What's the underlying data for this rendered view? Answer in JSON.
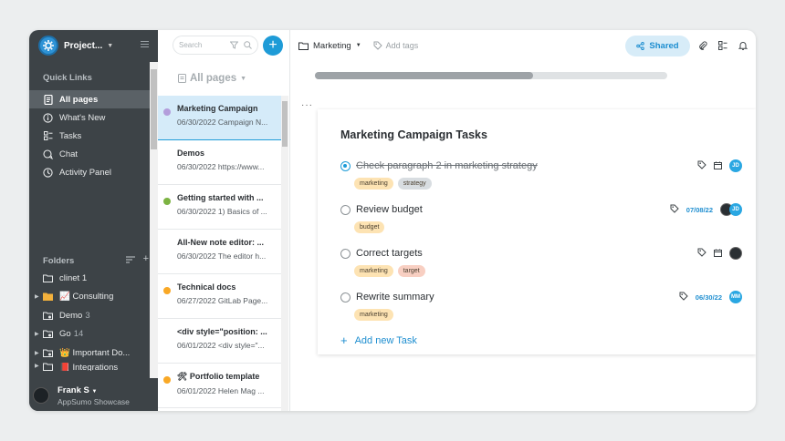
{
  "sidebar": {
    "workspace_name": "Project...",
    "quick_links_title": "Quick Links",
    "quick_links": [
      {
        "label": "All pages",
        "icon": "pages-icon"
      },
      {
        "label": "What's New",
        "icon": "info-icon"
      },
      {
        "label": "Tasks",
        "icon": "tasks-icon"
      },
      {
        "label": "Chat",
        "icon": "chat-icon"
      },
      {
        "label": "Activity Panel",
        "icon": "activity-icon"
      }
    ],
    "folders_title": "Folders",
    "folders": [
      {
        "name": "clinet 1",
        "count": ""
      },
      {
        "name": "📈 Consulting",
        "count": ""
      },
      {
        "name": "Demo",
        "count": "3"
      },
      {
        "name": "Go",
        "count": "14"
      },
      {
        "name": "👑 Important Do...",
        "count": ""
      },
      {
        "name": "📕 Integrations",
        "count": ""
      }
    ],
    "profile": {
      "name": "Frank S",
      "subtitle": "AppSumo Showcase"
    }
  },
  "notes_list": {
    "search_placeholder": "Search",
    "header": "All pages",
    "notes": [
      {
        "title": "Marketing Campaign",
        "meta": "06/30/2022 Campaign N...",
        "dot": "#b39ddb"
      },
      {
        "title": "Demos",
        "meta": "06/30/2022 https://www...",
        "dot": ""
      },
      {
        "title": "Getting started with ...",
        "meta": "06/30/2022 1) Basics of ...",
        "dot": "#7cb342"
      },
      {
        "title": "All-New note editor: ...",
        "meta": "06/30/2022 The editor h...",
        "dot": ""
      },
      {
        "title": "Technical docs",
        "meta": "06/27/2022 GitLab Page...",
        "dot": "#f9a825"
      },
      {
        "title": "<div style=\"position: ...",
        "meta": "06/01/2022 <div style=\"...",
        "dot": ""
      },
      {
        "title": "🛠 Portfolio template",
        "meta": "06/01/2022 Helen Mag ...",
        "dot": "#f9a825"
      }
    ]
  },
  "topbar": {
    "folder": "Marketing",
    "add_tags": "Add tags",
    "shared": "Shared"
  },
  "progress": {
    "value": 0.62
  },
  "card": {
    "title": "Marketing Campaign Tasks",
    "tasks": [
      {
        "text": "Check paragraph 2 in marketing strategy",
        "done": true,
        "tags": [
          "marketing",
          "strategy"
        ],
        "date": "",
        "avatars": [
          "JD"
        ]
      },
      {
        "text": "Review budget",
        "done": false,
        "tags": [
          "budget"
        ],
        "date": "07/08/22",
        "avatars": [
          "",
          "JD"
        ]
      },
      {
        "text": "Correct targets",
        "done": false,
        "tags": [
          "marketing",
          "target"
        ],
        "date": "",
        "avatars": [
          ""
        ]
      },
      {
        "text": "Rewrite summary",
        "done": false,
        "tags": [
          "marketing"
        ],
        "date": "06/30/22",
        "avatars": [
          "MM"
        ]
      }
    ],
    "add_new": "Add new Task"
  },
  "colors": {
    "accent": "#1e9bd7",
    "sidebar_bg": "#3d4347",
    "tag_marketing": "#fde3b3",
    "tag_strategy": "#d8dde1",
    "tag_budget": "#fde3b3",
    "tag_target": "#f8cfc2"
  }
}
